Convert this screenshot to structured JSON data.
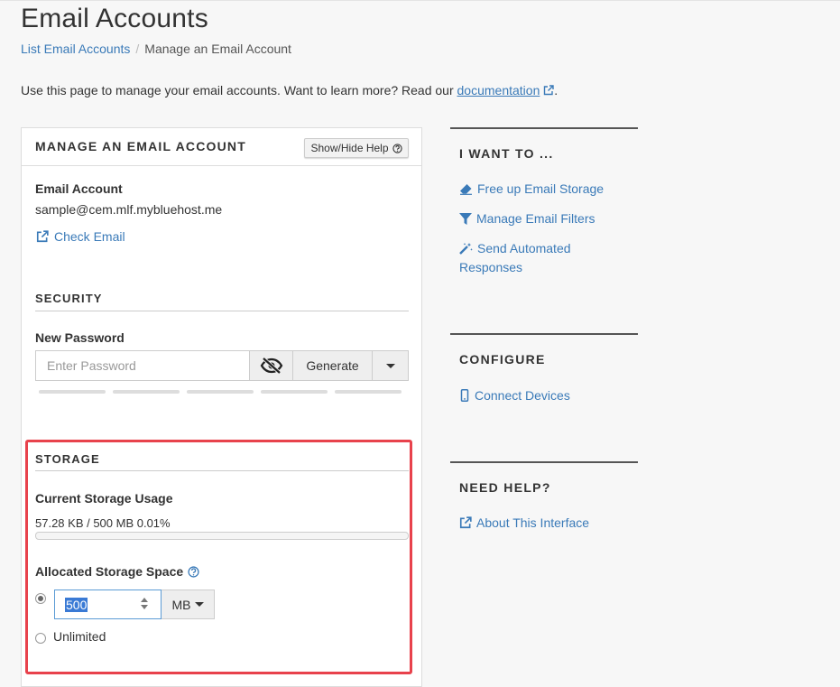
{
  "page": {
    "title": "Email Accounts",
    "breadcrumb": {
      "parent": "List Email Accounts",
      "separator": "/",
      "current": "Manage an Email Account"
    },
    "intro": {
      "text": "Use this page to manage your email accounts. Want to learn more? Read our ",
      "link": "documentation",
      "end": "."
    }
  },
  "panel": {
    "title": "MANAGE AN EMAIL ACCOUNT",
    "help_button": "Show/Hide Help",
    "account": {
      "label": "Email Account",
      "email": "sample@cem.mlf.mybluehost.me",
      "check_email": "Check Email"
    },
    "security": {
      "title": "SECURITY",
      "new_password_label": "New Password",
      "password_placeholder": "Enter Password",
      "generate_label": "Generate"
    },
    "storage": {
      "title": "STORAGE",
      "current_usage_label": "Current Storage Usage",
      "usage_text": "57.28 KB / 500 MB 0.01%",
      "usage_fraction": 0.0001,
      "allocated_label": "Allocated Storage Space",
      "quota_value": "500",
      "unit": "MB",
      "unlimited_label": "Unlimited"
    }
  },
  "sidebar": {
    "want_to": {
      "title": "I WANT TO ...",
      "items": [
        "Free up Email Storage",
        "Manage Email Filters",
        "Send Automated Responses"
      ]
    },
    "configure": {
      "title": "CONFIGURE",
      "items": [
        "Connect Devices"
      ]
    },
    "help": {
      "title": "NEED HELP?",
      "items": [
        "About This Interface"
      ]
    }
  },
  "colors": {
    "link": "#3a7ab8",
    "highlight": "#e8424c",
    "selection": "#3a7ad5"
  }
}
